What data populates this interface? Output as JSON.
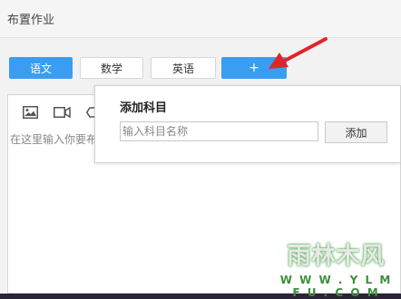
{
  "window": {
    "title": "布置作业"
  },
  "subjects": {
    "items": [
      {
        "label": "语文",
        "active": true
      },
      {
        "label": "数学",
        "active": false
      },
      {
        "label": "英语",
        "active": false
      }
    ],
    "add_label": "+"
  },
  "editor": {
    "placeholder": "在这里输入你要布",
    "tools": [
      "image-icon",
      "video-icon",
      "eraser-icon"
    ]
  },
  "popup": {
    "title": "添加科目",
    "input_placeholder": "输入科目名称",
    "input_value": "",
    "add_label": "添加"
  },
  "annotation": {
    "arrow_color": "#e0242b"
  },
  "colors": {
    "accent": "#3a9df2"
  },
  "watermark": {
    "main": "雨林木风",
    "sub": "W W W . Y L M F U . C O M"
  }
}
